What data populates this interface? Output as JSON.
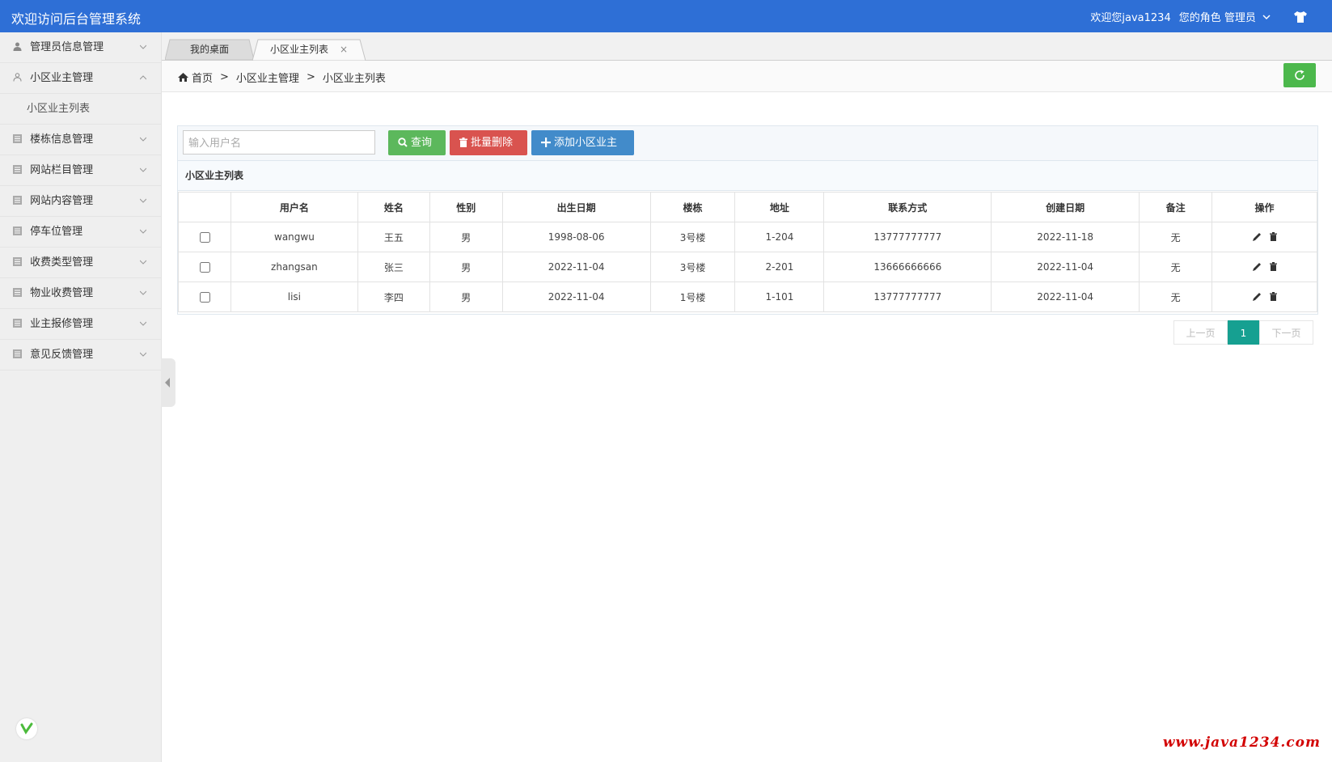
{
  "header": {
    "title": "欢迎访问后台管理系统",
    "welcome": "欢迎您java1234",
    "role": "您的角色 管理员"
  },
  "sidebar": {
    "items": [
      {
        "label": "管理员信息管理",
        "icon": "user-icon",
        "expanded": false
      },
      {
        "label": "小区业主管理",
        "icon": "user-outline-icon",
        "expanded": true,
        "children": [
          {
            "label": "小区业主列表"
          }
        ]
      },
      {
        "label": "楼栋信息管理",
        "icon": "list-icon",
        "expanded": false
      },
      {
        "label": "网站栏目管理",
        "icon": "list-icon",
        "expanded": false
      },
      {
        "label": "网站内容管理",
        "icon": "list-icon",
        "expanded": false
      },
      {
        "label": "停车位管理",
        "icon": "list-icon",
        "expanded": false
      },
      {
        "label": "收费类型管理",
        "icon": "list-icon",
        "expanded": false
      },
      {
        "label": "物业收费管理",
        "icon": "list-icon",
        "expanded": false
      },
      {
        "label": "业主报修管理",
        "icon": "list-icon",
        "expanded": false
      },
      {
        "label": "意见反馈管理",
        "icon": "list-icon",
        "expanded": false
      }
    ]
  },
  "tabs": [
    {
      "label": "我的桌面",
      "active": false
    },
    {
      "label": "小区业主列表",
      "active": true,
      "close": "×"
    }
  ],
  "breadcrumb": {
    "home": "首页",
    "sep": ">",
    "level1": "小区业主管理",
    "level2": "小区业主列表"
  },
  "toolbar": {
    "search_placeholder": "输入用户名",
    "search_label": "查询",
    "batch_delete_label": "批量删除",
    "add_label": "添加小区业主"
  },
  "panel_title": "小区业主列表",
  "table": {
    "headers": [
      "",
      "用户名",
      "姓名",
      "性别",
      "出生日期",
      "楼栋",
      "地址",
      "联系方式",
      "创建日期",
      "备注",
      "操作"
    ],
    "rows": [
      {
        "username": "wangwu",
        "name": "王五",
        "gender": "男",
        "birth": "1998-08-06",
        "building": "3号楼",
        "address": "1-204",
        "phone": "13777777777",
        "created": "2022-11-18",
        "note": "无"
      },
      {
        "username": "zhangsan",
        "name": "张三",
        "gender": "男",
        "birth": "2022-11-04",
        "building": "3号楼",
        "address": "2-201",
        "phone": "13666666666",
        "created": "2022-11-04",
        "note": "无"
      },
      {
        "username": "lisi",
        "name": "李四",
        "gender": "男",
        "birth": "2022-11-04",
        "building": "1号楼",
        "address": "1-101",
        "phone": "13777777777",
        "created": "2022-11-04",
        "note": "无"
      }
    ]
  },
  "pager": {
    "prev": "上一页",
    "current": "1",
    "next": "下一页"
  },
  "watermark": "www.java1234.com",
  "colors": {
    "header": "#2e6fd6",
    "search": "#5cb85c",
    "delete": "#d9534f",
    "add": "#428bca",
    "pager_active": "#16a091"
  }
}
